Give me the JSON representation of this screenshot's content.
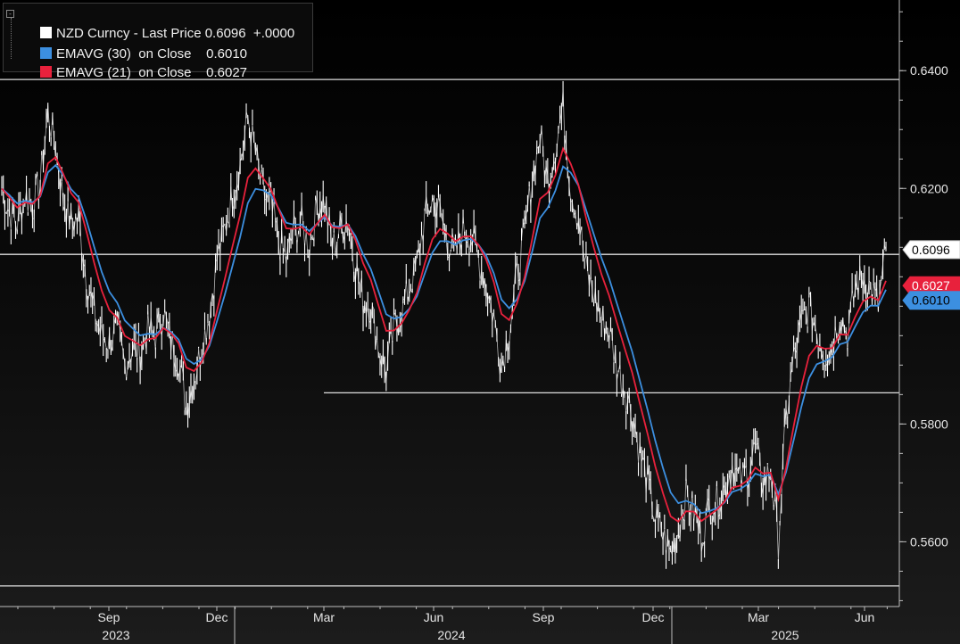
{
  "legend": {
    "rows": [
      {
        "label": "NZD Curncy - Last Price 0.6096  +.0000",
        "color": "#ffffff"
      },
      {
        "label": "EMAVG (30)  on Close    0.6010",
        "color": "#3c8fe0"
      },
      {
        "label": "EMAVG (21)  on Close    0.6027",
        "color": "#e8213c"
      }
    ]
  },
  "chart_data": {
    "type": "line",
    "y_range": [
      0.549,
      0.652
    ],
    "y_ticks": [
      {
        "value": 0.64,
        "label": "0.6400"
      },
      {
        "value": 0.62,
        "label": "0.6200"
      },
      {
        "value": 0.58,
        "label": "0.5800"
      },
      {
        "value": 0.56,
        "label": "0.5600"
      }
    ],
    "x_month_ticks": [
      "Sep",
      "Dec",
      "Mar",
      "Jun",
      "Sep",
      "Dec",
      "Mar",
      "Jun"
    ],
    "x_year_labels": [
      "2023",
      "2024",
      "2025"
    ],
    "horizontal_levels": [
      0.6385,
      0.6088,
      0.5853,
      0.5525
    ],
    "price": {
      "name": "NZD Curncy - Last Price",
      "color": "#ffffff",
      "last": 0.6096,
      "last_label": "0.6096",
      "weekly": [
        0.62,
        0.616,
        0.614,
        0.619,
        0.617,
        0.621,
        0.633,
        0.627,
        0.618,
        0.614,
        0.615,
        0.605,
        0.599,
        0.595,
        0.594,
        0.596,
        0.59,
        0.593,
        0.592,
        0.596,
        0.595,
        0.599,
        0.594,
        0.591,
        0.583,
        0.588,
        0.593,
        0.599,
        0.608,
        0.613,
        0.619,
        0.624,
        0.632,
        0.626,
        0.619,
        0.617,
        0.611,
        0.608,
        0.613,
        0.614,
        0.61,
        0.617,
        0.618,
        0.61,
        0.613,
        0.615,
        0.607,
        0.601,
        0.6,
        0.593,
        0.589,
        0.596,
        0.599,
        0.603,
        0.607,
        0.615,
        0.618,
        0.616,
        0.611,
        0.609,
        0.613,
        0.612,
        0.608,
        0.604,
        0.598,
        0.59,
        0.596,
        0.605,
        0.612,
        0.622,
        0.629,
        0.621,
        0.627,
        0.634,
        0.62,
        0.615,
        0.606,
        0.602,
        0.598,
        0.596,
        0.59,
        0.586,
        0.582,
        0.575,
        0.57,
        0.564,
        0.561,
        0.558,
        0.562,
        0.568,
        0.565,
        0.561,
        0.566,
        0.567,
        0.569,
        0.573,
        0.57,
        0.572,
        0.576,
        0.57,
        0.572,
        0.56,
        0.581,
        0.591,
        0.597,
        0.6,
        0.596,
        0.592,
        0.593,
        0.599,
        0.595,
        0.603,
        0.605,
        0.603,
        0.6,
        0.6096
      ]
    },
    "ema21": {
      "name": "EMAVG (21) on Close",
      "color": "#e8213c",
      "last": 0.6027,
      "last_label": "0.6027"
    },
    "ema30": {
      "name": "EMAVG (30) on Close",
      "color": "#3c8fe0",
      "last": 0.601,
      "last_label": "0.6010"
    },
    "colors": {
      "axis": "#bdbdbd",
      "level_line": "#e0e0e0"
    }
  }
}
